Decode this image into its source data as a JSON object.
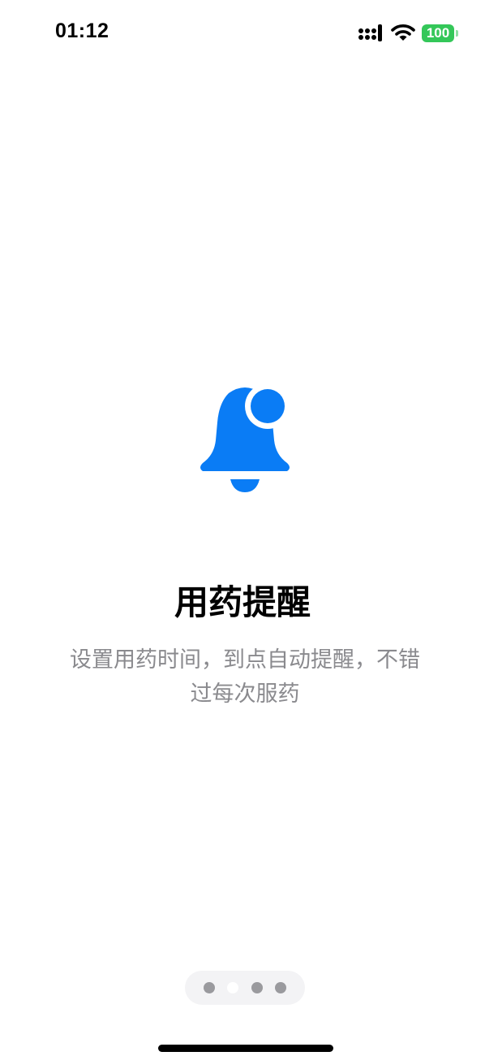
{
  "status_bar": {
    "time": "01:12",
    "battery_level": "100",
    "battery_color": "#34c759"
  },
  "onboarding": {
    "icon": "bell-icon",
    "accent_color": "#0a7cf5",
    "title": "用药提醒",
    "description": "设置用药时间，到点自动提醒，不错过每次服药"
  },
  "pager": {
    "page_count": 4,
    "current_page": 2
  }
}
